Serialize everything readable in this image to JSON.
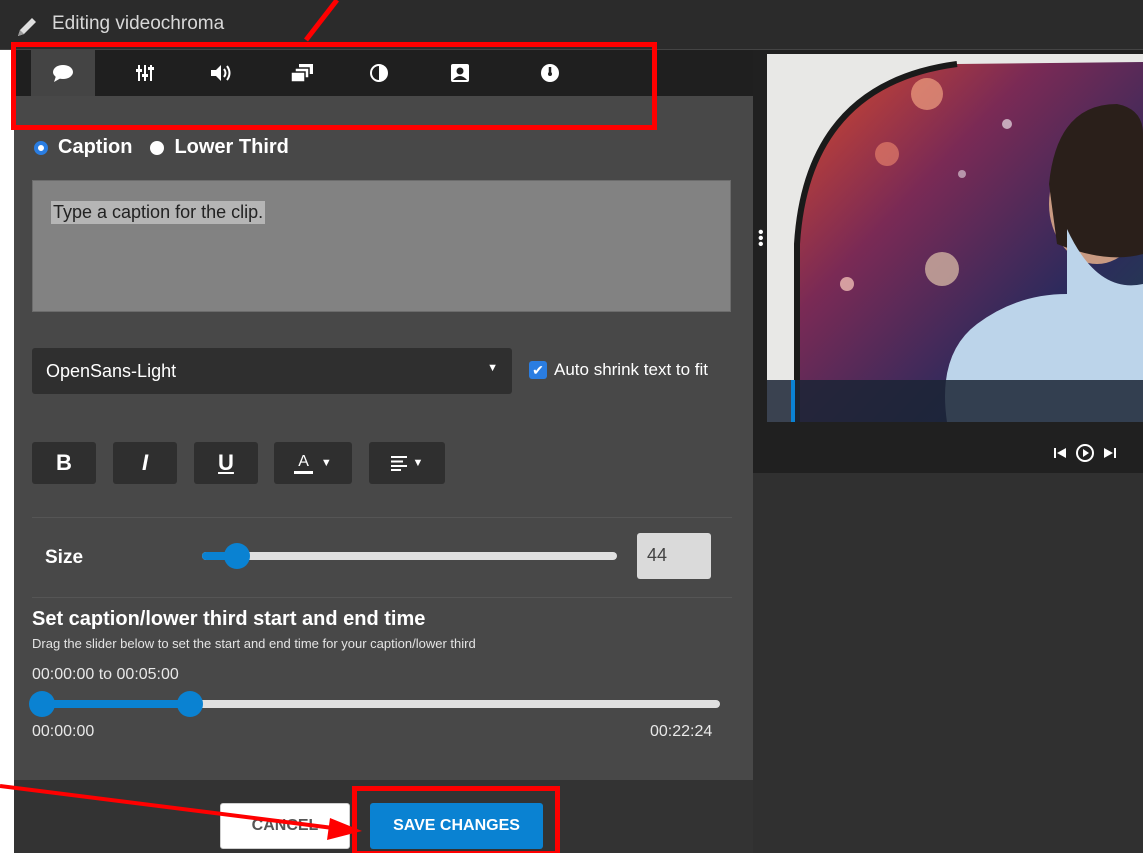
{
  "header": {
    "title": "Editing videochroma"
  },
  "tabs": [
    {
      "name": "captions",
      "icon": "speech-bubble-icon",
      "active": true
    },
    {
      "name": "adjustments",
      "icon": "sliders-icon"
    },
    {
      "name": "audio",
      "icon": "speaker-icon"
    },
    {
      "name": "layers",
      "icon": "layers-icon"
    },
    {
      "name": "color",
      "icon": "contrast-icon"
    },
    {
      "name": "portrait",
      "icon": "portrait-icon"
    },
    {
      "name": "speed",
      "icon": "gauge-icon"
    }
  ],
  "caption_type": {
    "options": [
      "Caption",
      "Lower Third"
    ],
    "selected": "Caption"
  },
  "caption_text": {
    "placeholder": "Type a caption for the clip."
  },
  "font": {
    "selected": "OpenSans-Light"
  },
  "auto_shrink": {
    "label": "Auto shrink text to fit",
    "checked": true
  },
  "format_buttons": {
    "bold": "B",
    "italic": "I",
    "underline": "U",
    "color": "A",
    "align": "align-icon"
  },
  "size": {
    "label": "Size",
    "value": "44"
  },
  "timing": {
    "title": "Set caption/lower third start and end time",
    "description": "Drag the slider below to set the start and end time for your caption/lower third",
    "range_text": "00:00:00 to 00:05:00",
    "min_label": "00:00:00",
    "max_label": "00:22:24"
  },
  "actions": {
    "cancel": "CANCEL",
    "save": "SAVE CHANGES"
  },
  "colors": {
    "accent": "#0a82d2",
    "annotation": "#ff0000",
    "panel": "#484848"
  }
}
